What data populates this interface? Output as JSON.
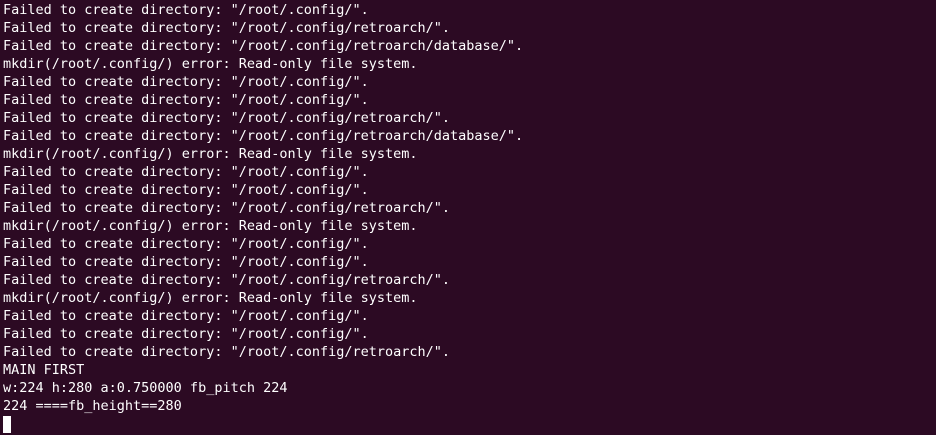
{
  "terminal": {
    "lines": [
      "Failed to create directory: \"/root/.config/\".",
      "Failed to create directory: \"/root/.config/retroarch/\".",
      "Failed to create directory: \"/root/.config/retroarch/database/\".",
      "mkdir(/root/.config/) error: Read-only file system.",
      "Failed to create directory: \"/root/.config/\".",
      "Failed to create directory: \"/root/.config/\".",
      "Failed to create directory: \"/root/.config/retroarch/\".",
      "Failed to create directory: \"/root/.config/retroarch/database/\".",
      "mkdir(/root/.config/) error: Read-only file system.",
      "Failed to create directory: \"/root/.config/\".",
      "Failed to create directory: \"/root/.config/\".",
      "Failed to create directory: \"/root/.config/retroarch/\".",
      "mkdir(/root/.config/) error: Read-only file system.",
      "Failed to create directory: \"/root/.config/\".",
      "Failed to create directory: \"/root/.config/\".",
      "Failed to create directory: \"/root/.config/retroarch/\".",
      "mkdir(/root/.config/) error: Read-only file system.",
      "Failed to create directory: \"/root/.config/\".",
      "Failed to create directory: \"/root/.config/\".",
      "Failed to create directory: \"/root/.config/retroarch/\".",
      "MAIN FIRST",
      "w:224 h:280 a:0.750000 fb_pitch 224",
      "224 ====fb_height==280"
    ]
  },
  "colors": {
    "background": "#2c0a23",
    "foreground": "#ffffff"
  }
}
